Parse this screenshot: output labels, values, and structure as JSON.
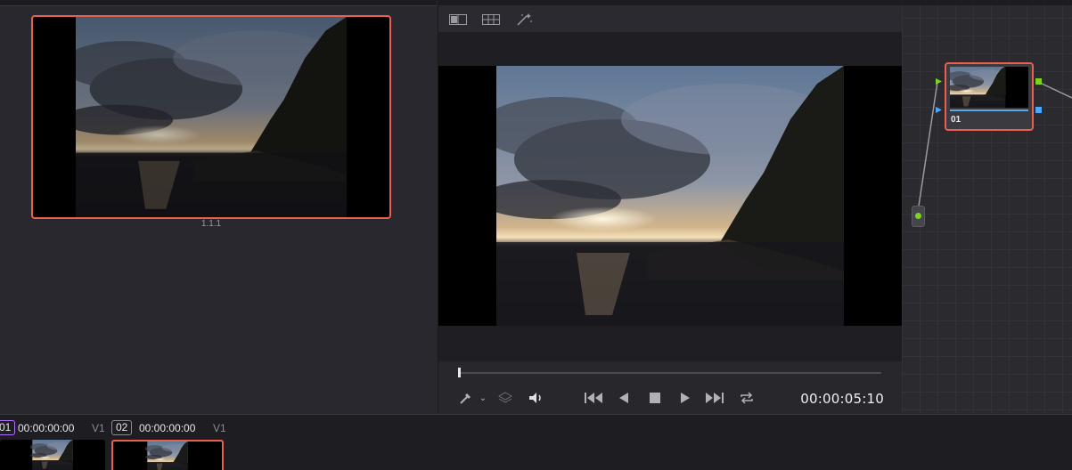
{
  "gallery": {
    "still_label": "1.1.1"
  },
  "viewer": {
    "toolbar": {
      "icons": [
        "split-screen-icon",
        "grid-icon",
        "magic-wand-icon"
      ]
    },
    "playback_progress": 0.0,
    "timecode": "00:00:05:10",
    "controls": [
      "color-picker-icon",
      "chevron-down-icon",
      "layers-icon",
      "volume-icon",
      "skip-to-start-icon",
      "play-reverse-icon",
      "stop-icon",
      "play-icon",
      "skip-to-end-icon",
      "loop-icon"
    ]
  },
  "node_editor": {
    "node_label": "01"
  },
  "clips": [
    {
      "number": "01",
      "timecode": "00:00:00:00",
      "track": "V1",
      "selected": false
    },
    {
      "number": "02",
      "timecode": "00:00:00:00",
      "track": "V1",
      "selected": true
    }
  ],
  "colors": {
    "selection": "#e8604f",
    "node_input_green": "#7ed321",
    "node_output_blue": "#4aa8ff",
    "accent_purple": "#b070ff"
  }
}
